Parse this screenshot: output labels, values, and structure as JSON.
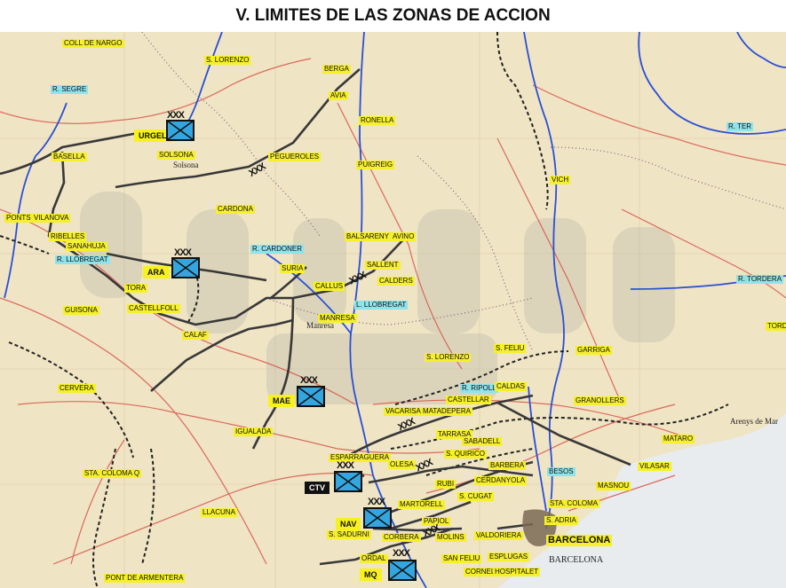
{
  "title": "V. LIMITES DE LAS ZONAS DE ACCION",
  "units": [
    {
      "id": "urgel",
      "label": "URGEL",
      "echelon": "XXX",
      "color": "#34a6df"
    },
    {
      "id": "ara",
      "label": "ARA",
      "echelon": "XXX",
      "color": "#34a6df"
    },
    {
      "id": "mae",
      "label": "MAE",
      "echelon": "XXX",
      "color": "#34a6df"
    },
    {
      "id": "ctv",
      "label": "CTV",
      "echelon": "XXX",
      "color": "#34a6df"
    },
    {
      "id": "nav",
      "label": "NAV",
      "echelon": "XXX",
      "color": "#34a6df"
    },
    {
      "id": "mq",
      "label": "MQ",
      "echelon": "XXX",
      "color": "#34a6df"
    }
  ],
  "boundary_marker": "XXX",
  "rivers": [
    "R. SEGRE",
    "R. TER",
    "R. CARDONER",
    "R. LLOBREGAT",
    "R. TORDERA",
    "L. LLOBREGAT",
    "R. RIPOLL",
    "BESOS"
  ],
  "places": {
    "coll_de_nargo": "COLL DE NARGO",
    "s_lorenzo_n": "S. LORENZO",
    "berga": "BERGA",
    "avia": "AVIA",
    "ronella": "RONELLA",
    "pegueroles": "PEGUEROLES",
    "puigreig": "PUIGREIG",
    "basella": "BASELLA",
    "solsona": "SOLSONA",
    "vich": "VICH",
    "cardona": "CARDONA",
    "ponts": "PONTS",
    "vilanova": "VILANOVA",
    "balsareny": "BALSARENY",
    "avino": "AVINO",
    "sallent": "SALLENT",
    "calders": "CALDERS",
    "ribelles": "RIBELLES",
    "sanahuja": "SANAHUJA",
    "suria": "SURIA",
    "callus": "CALLUS",
    "tora": "TORA",
    "guisona": "GUISONA",
    "castellfollit": "CASTELLFOLL",
    "calaf": "CALAF",
    "manresa": "MANRESA",
    "s_feliu": "S. FELIU",
    "garriga": "GARRIGA",
    "s_lorenzo_s": "S. LORENZO",
    "cervera": "CERVERA",
    "caldas": "CALDAS",
    "castellar": "CASTELLAR",
    "granollers": "GRANOLLERS",
    "vacarisas": "VACARISAS",
    "matadepera": "MATADEPERA",
    "tarrasa": "TARRASA",
    "igualada": "IGUALADA",
    "sabadell": "SABADELL",
    "mataro": "MATARO",
    "esparraguera": "ESPARRAGUERA",
    "olesa": "OLESA",
    "s_quirico": "S. QUIRICO",
    "barbera": "BARBERA",
    "vilasar": "VILASAR",
    "santa_coloma_q": "STA. COLOMA Q",
    "martorell": "MARTORELL",
    "rubi": "RUBI",
    "cerdanyola": "CERDANYOLA",
    "masnou": "MASNOU",
    "s_cugat": "S. CUGAT",
    "sta_coloma": "STA. COLOMA",
    "llacuna": "LLACUNA",
    "papiol": "PAPIOL",
    "s_adria": "S. ADRIA",
    "s_sadurni": "S. SADURNI",
    "corbera": "CORBERA",
    "molins": "MOLINS",
    "valdoriera": "VALDORIERA",
    "barcelona": "BARCELONA",
    "pont_de_armentera": "PONT DE ARMENTERA",
    "ordal": "ORDAL",
    "san_feliu": "SAN FELIU",
    "esplugas": "ESPLUGAS",
    "cornella": "CORNELL",
    "hospitalet": "HOSPITALET",
    "solsona_map": "Solsona",
    "manresa_map": "Manresa",
    "barcelona_map": "BARCELONA",
    "arenys": "Arenys de Mar",
    "tord": "TORDE"
  }
}
